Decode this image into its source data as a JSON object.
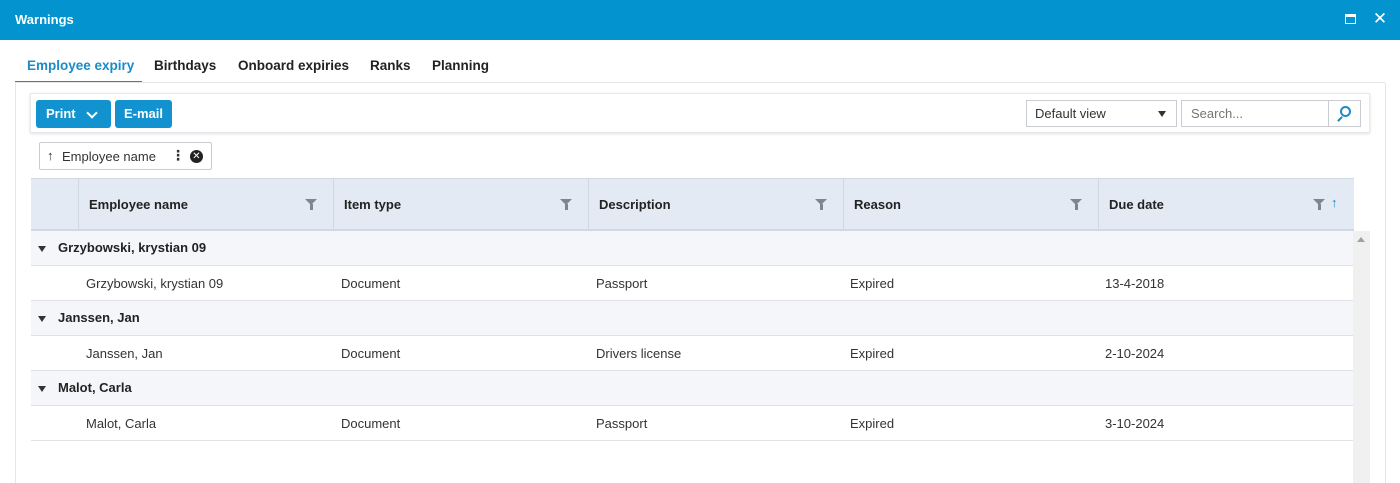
{
  "window": {
    "title": "Warnings"
  },
  "tabs": [
    {
      "label": "Employee expiry",
      "active": true
    },
    {
      "label": "Birthdays",
      "active": false
    },
    {
      "label": "Onboard expiries",
      "active": false
    },
    {
      "label": "Ranks",
      "active": false
    },
    {
      "label": "Planning",
      "active": false
    }
  ],
  "toolbar": {
    "print_label": "Print",
    "email_label": "E-mail",
    "view_select_value": "Default view",
    "search_placeholder": "Search..."
  },
  "grouping_chip": {
    "sort_arrow": "↑",
    "label": "Employee name"
  },
  "grid": {
    "columns": [
      "Employee name",
      "Item type",
      "Description",
      "Reason",
      "Due date"
    ],
    "groups": [
      {
        "name": "Grzybowski, krystian 09",
        "rows": [
          [
            "Grzybowski, krystian 09",
            "Document",
            "Passport",
            "Expired",
            "13-4-2018"
          ]
        ]
      },
      {
        "name": "Janssen, Jan",
        "rows": [
          [
            "Janssen, Jan",
            "Document",
            "Drivers license",
            "Expired",
            "2-10-2024"
          ]
        ]
      },
      {
        "name": "Malot, Carla",
        "rows": [
          [
            "Malot, Carla",
            "Document",
            "Passport",
            "Expired",
            "3-10-2024"
          ]
        ]
      }
    ]
  },
  "colors": {
    "titlebar": "#0393cf",
    "accent": "#1a8cc7",
    "button": "#1293cf",
    "header_bg": "#e3eaf3",
    "group_bg": "#f4f6f9"
  },
  "icons": {
    "maximize": "maximize-icon",
    "close": "close-icon",
    "dropdown": "chevron-down-icon",
    "search": "search-icon",
    "filter": "filter-icon",
    "sort": "sort-ascending-icon",
    "remove": "remove-circle-icon",
    "more": "more-vertical-icon",
    "collapse": "collapse-triangle-icon"
  }
}
